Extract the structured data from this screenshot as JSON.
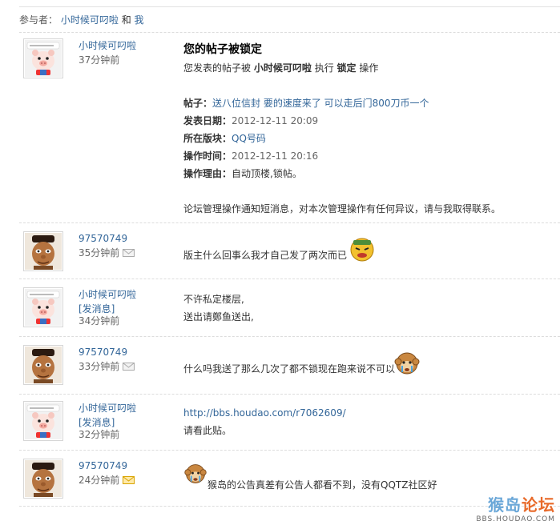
{
  "participants": {
    "label": "参与者：",
    "user1": "小时候可叼啦",
    "and": "和",
    "user2": "我"
  },
  "system_message": {
    "author": "小时候可叼啦",
    "time": "37分钟前",
    "title": "您的帖子被锁定",
    "intro_prefix": "您发表的帖子被",
    "intro_user": "小时候可叼啦",
    "intro_middle": "执行",
    "intro_action": "锁定",
    "intro_suffix": "操作",
    "post_label": "帖子：",
    "post_title": "送八位信封  要的速度来了 可以走后门800刀币一个",
    "date_label": "发表日期：",
    "date_value": "2012-12-11 20:09",
    "board_label": "所在版块：",
    "board_value": "QQ号码",
    "optime_label": "操作时间：",
    "optime_value": "2012-12-11 20:16",
    "reason_label": "操作理由：",
    "reason_value": "自动顶楼,锁帖。",
    "footer": "论坛管理操作通知短消息，对本次管理操作有任何异议，请与我取得联系。"
  },
  "messages": [
    {
      "author": "97570749",
      "send_link": "",
      "time": "35分钟前",
      "text": "版主什么回事么我才自己发了两次而已",
      "text2": ""
    },
    {
      "author": "小时候可叼啦",
      "send_link": "[发消息]",
      "time": "34分钟前",
      "text": "不许私定楼层,",
      "text2": "送出请鄭鱼送出,"
    },
    {
      "author": "97570749",
      "send_link": "",
      "time": "33分钟前",
      "text": "什么吗我送了那么几次了都不锁现在跑来说不可以",
      "text2": ""
    },
    {
      "author": "小时候可叼啦",
      "send_link": "[发消息]",
      "time": "32分钟前",
      "text": "http://bbs.houdao.com/r7062609/",
      "text2": "请看此贴。"
    },
    {
      "author": "97570749",
      "send_link": "",
      "time": "24分钟前",
      "text": "猴岛的公告真差有公告人都看不到，没有QQTZ社区好",
      "text2": ""
    }
  ],
  "watermark": {
    "main_a": "猴岛",
    "main_b": "论坛",
    "url": "BBS.HOUDAO.COM"
  },
  "colors": {
    "link": "#336699",
    "divider": "#dcdcdc",
    "watermark_orange": "#e86a2a",
    "watermark_blue": "#6aa7d8"
  }
}
